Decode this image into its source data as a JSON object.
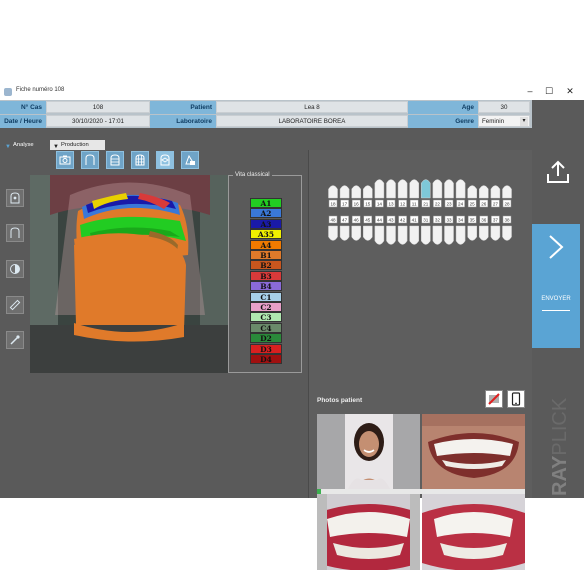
{
  "window": {
    "title": "Fiche numéro 108",
    "minimize": "–",
    "maximize": "☐",
    "close": "✕"
  },
  "header": {
    "n_cas_label": "N° Cas",
    "n_cas_value": "108",
    "patient_label": "Patient",
    "patient_value": "Lea 8",
    "age_label": "Age",
    "age_value": "30",
    "date_label": "Date / Heure",
    "date_value": "30/10/2020 - 17:01",
    "laboratoire_label": "Laboratoire",
    "laboratoire_value": "LABORATOIRE BOREA",
    "genre_label": "Genre",
    "genre_value": "Feminin"
  },
  "tabs": [
    "Analyse",
    "Production"
  ],
  "vita": {
    "title": "Vita classical",
    "shades": [
      {
        "label": "A1",
        "color": "#22cc22",
        "text": "#111"
      },
      {
        "label": "A2",
        "color": "#3a78d8",
        "text": "#111"
      },
      {
        "label": "A3",
        "color": "#1a1aa8",
        "text": "#111"
      },
      {
        "label": "A35",
        "color": "#f0f000",
        "text": "#111"
      },
      {
        "label": "A4",
        "color": "#f07a00",
        "text": "#111"
      },
      {
        "label": "B1",
        "color": "#e07a2a",
        "text": "#111"
      },
      {
        "label": "B2",
        "color": "#c8561e",
        "text": "#111"
      },
      {
        "label": "B3",
        "color": "#d83a3a",
        "text": "#111"
      },
      {
        "label": "B4",
        "color": "#8a6ad8",
        "text": "#111"
      },
      {
        "label": "C1",
        "color": "#a8d0e8",
        "text": "#111"
      },
      {
        "label": "C2",
        "color": "#e8a0c8",
        "text": "#111"
      },
      {
        "label": "C3",
        "color": "#b0e8b0",
        "text": "#111"
      },
      {
        "label": "C4",
        "color": "#6a8a6a",
        "text": "#111"
      },
      {
        "label": "D2",
        "color": "#2a8a3a",
        "text": "#111"
      },
      {
        "label": "D3",
        "color": "#d82020",
        "text": "#111"
      },
      {
        "label": "D4",
        "color": "#a01010",
        "text": "#111"
      }
    ]
  },
  "tooth_chart": {
    "upper": [
      "18",
      "17",
      "16",
      "15",
      "14",
      "13",
      "12",
      "11",
      "21",
      "22",
      "23",
      "24",
      "25",
      "26",
      "27",
      "28"
    ],
    "lower": [
      "48",
      "47",
      "46",
      "45",
      "44",
      "43",
      "42",
      "41",
      "31",
      "32",
      "33",
      "34",
      "35",
      "36",
      "37",
      "38"
    ],
    "selected": "21"
  },
  "photos": {
    "label": "Photos patient"
  },
  "sidebar": {
    "envoyer_label": "ENVOYER"
  },
  "brand": {
    "ray": "RAY",
    "plicker": "PLICKER"
  },
  "progress": 0.02,
  "colors": {
    "accent": "#5aa4d4",
    "header_label": "#7fb6d9",
    "panel": "#5a5a5a"
  },
  "icons": {
    "toolbar": [
      "camera-icon",
      "tooth-outline-icon",
      "tooth-grid-icon",
      "tooth-grid-full-icon",
      "tooth-3d-icon",
      "shade-guide-icon"
    ],
    "sidetools": [
      "tooth-target-icon",
      "tooth-crown-icon",
      "contrast-icon",
      "ruler-icon",
      "eyedropper-icon"
    ]
  }
}
